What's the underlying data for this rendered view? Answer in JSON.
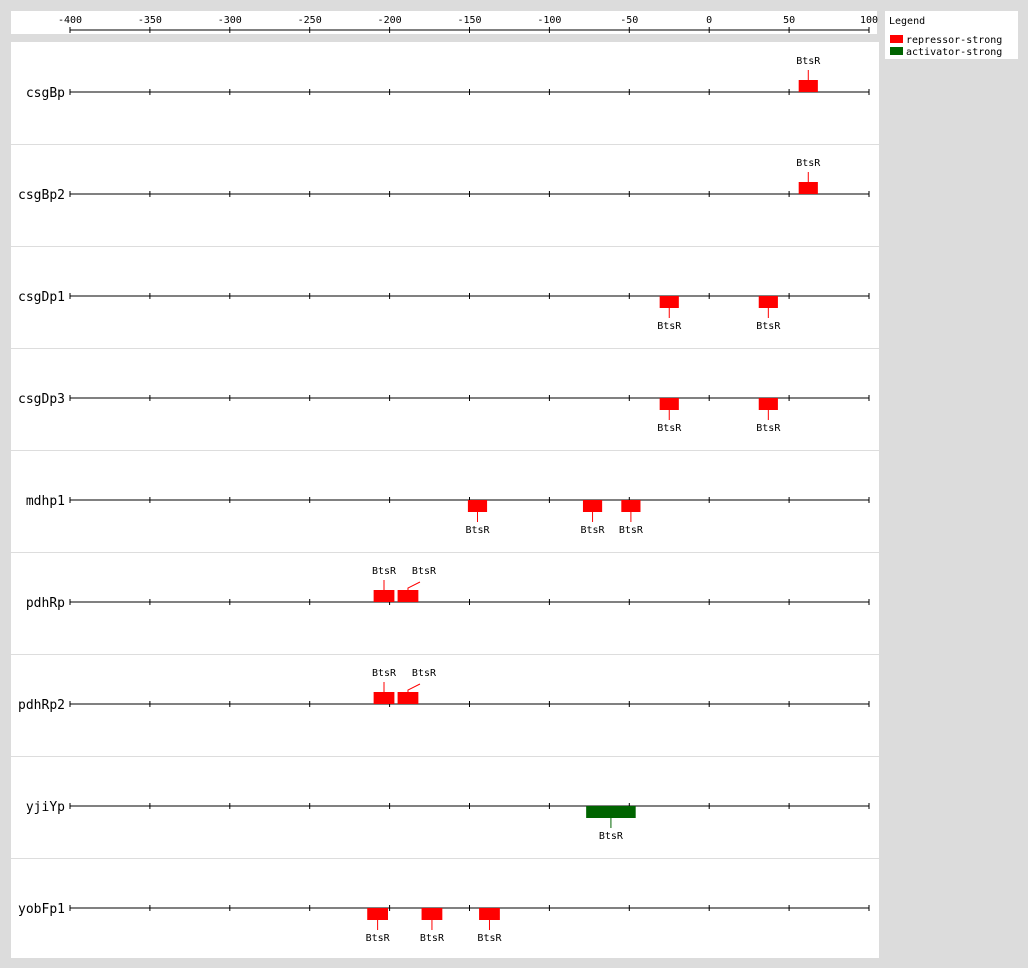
{
  "axis": {
    "min": -400,
    "max": 100,
    "ticks": [
      -400,
      -350,
      -300,
      -250,
      -200,
      -150,
      -100,
      -50,
      0,
      50,
      100
    ]
  },
  "legend": {
    "title": "Legend",
    "items": [
      {
        "label": "repressor-strong",
        "color": "#ff0000"
      },
      {
        "label": "activator-strong",
        "color": "#006400"
      }
    ]
  },
  "promoters": [
    {
      "name": "csgBp",
      "sites": [
        {
          "label": "BtsR",
          "start": 56,
          "end": 68,
          "type": "repressor-strong",
          "side": "above"
        }
      ]
    },
    {
      "name": "csgBp2",
      "sites": [
        {
          "label": "BtsR",
          "start": 56,
          "end": 68,
          "type": "repressor-strong",
          "side": "above"
        }
      ]
    },
    {
      "name": "csgDp1",
      "sites": [
        {
          "label": "BtsR",
          "start": -31,
          "end": -19,
          "type": "repressor-strong",
          "side": "below"
        },
        {
          "label": "BtsR",
          "start": 31,
          "end": 43,
          "type": "repressor-strong",
          "side": "below"
        }
      ]
    },
    {
      "name": "csgDp3",
      "sites": [
        {
          "label": "BtsR",
          "start": -31,
          "end": -19,
          "type": "repressor-strong",
          "side": "below"
        },
        {
          "label": "BtsR",
          "start": 31,
          "end": 43,
          "type": "repressor-strong",
          "side": "below"
        }
      ]
    },
    {
      "name": "mdhp1",
      "sites": [
        {
          "label": "BtsR",
          "start": -151,
          "end": -139,
          "type": "repressor-strong",
          "side": "below"
        },
        {
          "label": "BtsR",
          "start": -79,
          "end": -67,
          "type": "repressor-strong",
          "side": "below"
        },
        {
          "label": "BtsR",
          "start": -55,
          "end": -43,
          "type": "repressor-strong",
          "side": "below"
        }
      ]
    },
    {
      "name": "pdhRp",
      "sites": [
        {
          "label": "BtsR",
          "start": -210,
          "end": -197,
          "type": "repressor-strong",
          "side": "above"
        },
        {
          "label": "BtsR",
          "start": -195,
          "end": -182,
          "type": "repressor-strong",
          "side": "above",
          "offset": 1
        }
      ]
    },
    {
      "name": "pdhRp2",
      "sites": [
        {
          "label": "BtsR",
          "start": -210,
          "end": -197,
          "type": "repressor-strong",
          "side": "above"
        },
        {
          "label": "BtsR",
          "start": -195,
          "end": -182,
          "type": "repressor-strong",
          "side": "above",
          "offset": 1
        }
      ]
    },
    {
      "name": "yjiYp",
      "sites": [
        {
          "label": "BtsR",
          "start": -77,
          "end": -46,
          "type": "activator-strong",
          "side": "below"
        }
      ]
    },
    {
      "name": "yobFp1",
      "sites": [
        {
          "label": "BtsR",
          "start": -214,
          "end": -201,
          "type": "repressor-strong",
          "side": "below"
        },
        {
          "label": "BtsR",
          "start": -180,
          "end": -167,
          "type": "repressor-strong",
          "side": "below"
        },
        {
          "label": "BtsR",
          "start": -144,
          "end": -131,
          "type": "repressor-strong",
          "side": "below"
        }
      ]
    }
  ]
}
